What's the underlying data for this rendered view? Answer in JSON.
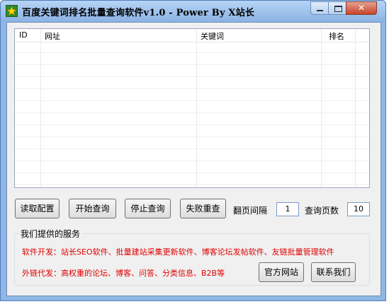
{
  "window": {
    "title": "百度关键词排名批量查询软件v1.0 - Power By X站长"
  },
  "grid": {
    "columns": [
      "ID",
      "网址",
      "关键词",
      "排名"
    ]
  },
  "buttons": {
    "read_config": "读取配置",
    "start_query": "开始查询",
    "stop_query": "停止查询",
    "retry_failed": "失败重查"
  },
  "settings": {
    "page_interval_label": "翻页间隔",
    "page_interval_value": "1",
    "query_pages_label": "查询页数",
    "query_pages_value": "10"
  },
  "services": {
    "title": "我们提供的服务",
    "software_dev": "软件开发：站长SEO软件、批量建站采集更新软件、博客论坛发帖软件、友链批量管理软件",
    "link_building": "外链代发：高权重的论坛、博客、问答、分类信息、B2B等",
    "official_site_button": "官方网站",
    "contact_button": "联系我们"
  },
  "colors": {
    "title_bar": "#8ab2e3",
    "service_text": "#e00000",
    "close_button": "#c8442b"
  },
  "icons": [
    "app-star-icon",
    "minimize-icon",
    "maximize-icon",
    "close-icon"
  ]
}
